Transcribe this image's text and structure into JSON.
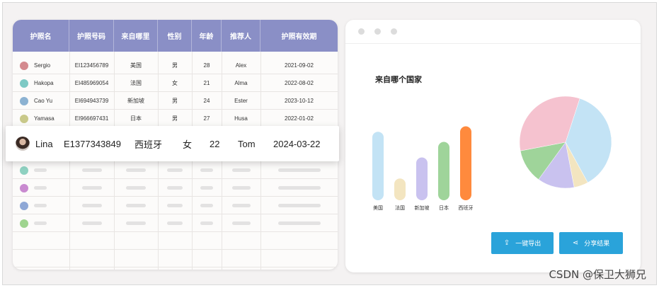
{
  "table": {
    "headers": [
      "护照名",
      "护照号码",
      "来自哪里",
      "性别",
      "年龄",
      "推荐人",
      "护照有效期"
    ],
    "rows": [
      {
        "color": "#d48a8f",
        "name": "Sergio",
        "passport": "EI123456789",
        "from": "美国",
        "gender": "男",
        "age": "28",
        "referrer": "Alex",
        "expiry": "2021-09-02"
      },
      {
        "color": "#7dc9c4",
        "name": "Hakopa",
        "passport": "EI485969054",
        "from": "法国",
        "gender": "女",
        "age": "21",
        "referrer": "Alma",
        "expiry": "2022-08-02"
      },
      {
        "color": "#8cb2d2",
        "name": "Cao Yu",
        "passport": "EI694943739",
        "from": "新加坡",
        "gender": "男",
        "age": "24",
        "referrer": "Ester",
        "expiry": "2023-10-12"
      },
      {
        "color": "#c9c98a",
        "name": "Yamasa",
        "passport": "EI966697431",
        "from": "日本",
        "gender": "男",
        "age": "27",
        "referrer": "Husa",
        "expiry": "2022-01-02"
      }
    ],
    "highlight": {
      "name": "Lina",
      "passport": "E1377343849",
      "from": "西班牙",
      "gender": "女",
      "age": "22",
      "referrer": "Tom",
      "expiry": "2024-03-22"
    },
    "placeholder_dot_colors": [
      "#8fd1c1",
      "#c98ad0",
      "#8fa8d6",
      "#9fd48f"
    ]
  },
  "chart_panel": {
    "title": "来自哪个国家",
    "export_button": "一键导出",
    "share_button": "分享结果"
  },
  "chart_data": [
    {
      "type": "bar",
      "title": "来自哪个国家",
      "categories": [
        "美国",
        "法国",
        "新加坡",
        "日本",
        "西班牙"
      ],
      "values": [
        88,
        28,
        55,
        75,
        95
      ],
      "colors": [
        "#c3e3f5",
        "#f3e5c0",
        "#c9c2ef",
        "#9fd49a",
        "#ff8a3d"
      ],
      "ylim": [
        0,
        100
      ]
    },
    {
      "type": "pie",
      "labels": [
        "美国",
        "法国",
        "新加坡",
        "日本",
        "西班牙"
      ],
      "values": [
        37,
        5,
        13,
        12,
        33
      ],
      "colors": [
        "#c3e3f5",
        "#f3e5c0",
        "#c9c2ef",
        "#9fd49a",
        "#f5c2cf"
      ]
    }
  ],
  "watermark": "CSDN @保卫大狮兄"
}
